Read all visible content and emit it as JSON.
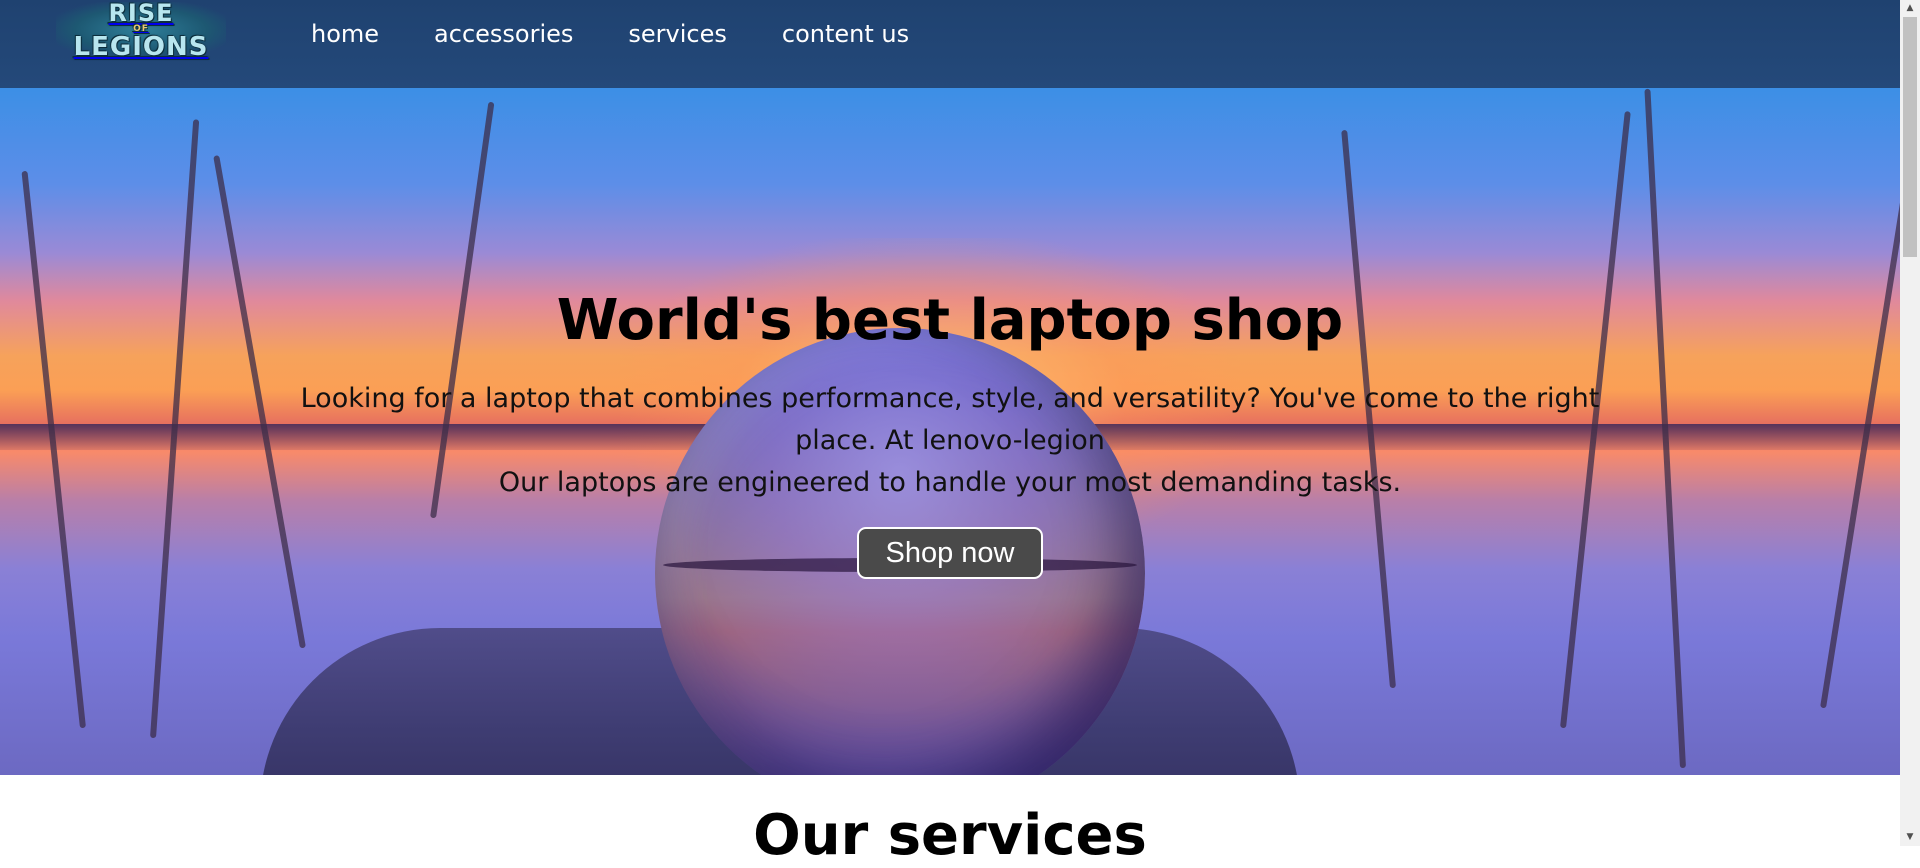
{
  "nav": {
    "logo": {
      "line1": "RISE",
      "line2": "OF",
      "line3": "LEGIONS"
    },
    "links": [
      {
        "label": "home"
      },
      {
        "label": "accessories"
      },
      {
        "label": "services"
      },
      {
        "label": "content us"
      }
    ]
  },
  "hero": {
    "title": "World's best laptop shop",
    "description_line1": "Looking for a laptop that combines performance, style, and versatility? You've come to the right place. At lenovo-legion",
    "description_line2": "Our laptops are engineered to handle your most demanding tasks.",
    "cta_label": "Shop now"
  },
  "services": {
    "heading": "Our services"
  },
  "scrollbar": {
    "up_arrow": "▲",
    "down_arrow": "▼"
  },
  "colors": {
    "navbar": "#24497a",
    "button": "#4a4a4a",
    "button_text": "#ffffff"
  }
}
